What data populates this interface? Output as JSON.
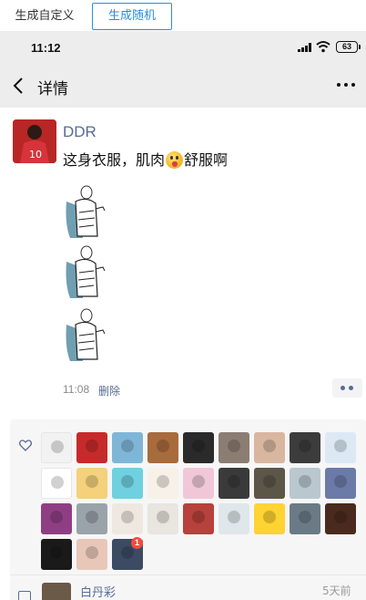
{
  "toolbar": {
    "custom_label": "生成自定义",
    "random_label": "生成随机",
    "active": "random"
  },
  "status_bar": {
    "time": "11:12",
    "battery": "63"
  },
  "nav": {
    "title": "详情"
  },
  "post": {
    "author": "DDR",
    "text_before": "这身衣服，肌肉",
    "text_after": "舒服啊",
    "emoji": "tongue-emoji",
    "images": [
      "monk-sketch-image",
      "monk-sketch-image",
      "monk-sketch-image"
    ],
    "time": "11:08",
    "delete_label": "删除"
  },
  "likes": {
    "count": 30,
    "avatar_colors": [
      "#f2f2f2",
      "#c72a2a",
      "#7fb6d8",
      "#a86b3c",
      "#2a2a2a",
      "#8c7d73",
      "#d9b6a0",
      "#3c3c3c",
      "#dce9f5",
      "#ffffff",
      "#f4d17a",
      "#6fd0e0",
      "#f7f1e8",
      "#f0c7d7",
      "#3a3a3a",
      "#5c5648",
      "#b9c7cf",
      "#6c7aa8",
      "#8e3f84",
      "#9aa3a9",
      "#efe8e1",
      "#e9e5df",
      "#b7413b",
      "#dfe7ea",
      "#ffd331",
      "#6a7b86",
      "#4a2a1e",
      "#1a1a1a",
      "#e8c7b8",
      "#3c4b63"
    ],
    "badge": "1"
  },
  "comment": {
    "name": "白丹彩",
    "time": "5天前"
  },
  "colors": {
    "link": "#576b95",
    "toolbar_active": "#2b8de0",
    "nav_bg": "#ededed"
  }
}
